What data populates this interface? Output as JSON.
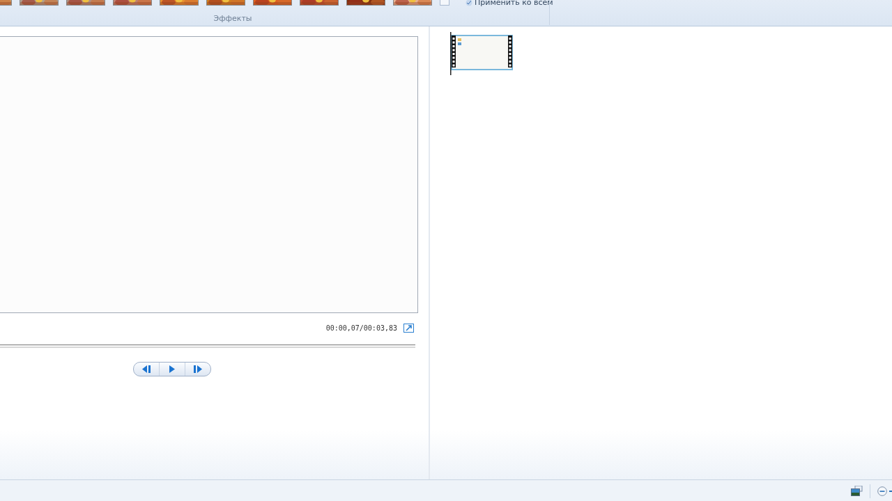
{
  "ribbon": {
    "apply_all": "Применить ко всем",
    "group_label": "Эффекты"
  },
  "preview": {
    "time": "00:00,07/00:03,83"
  },
  "storyboard": {
    "clips": [
      {
        "selected": true
      }
    ]
  }
}
